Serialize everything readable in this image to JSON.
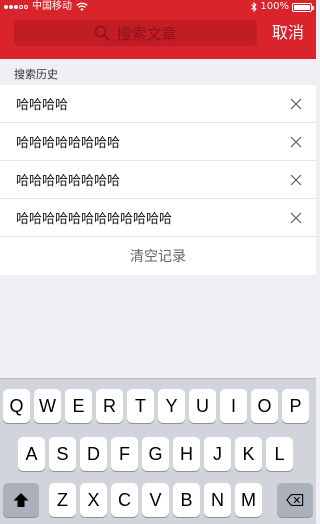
{
  "status_bar": {
    "carrier": "中国移动",
    "battery": "100%"
  },
  "search": {
    "placeholder": "搜索文章",
    "cancel_label": "取消"
  },
  "history": {
    "title": "搜索历史",
    "items": [
      {
        "label": "哈哈哈哈"
      },
      {
        "label": "哈哈哈哈哈哈哈哈"
      },
      {
        "label": "哈哈哈哈哈哈哈哈"
      },
      {
        "label": "哈哈哈哈哈哈哈哈哈哈哈哈"
      }
    ],
    "clear_label": "清空记录"
  },
  "keyboard": {
    "row1": [
      "Q",
      "W",
      "E",
      "R",
      "T",
      "Y",
      "U",
      "I",
      "O",
      "P"
    ],
    "row2": [
      "A",
      "S",
      "D",
      "F",
      "G",
      "H",
      "J",
      "K",
      "L"
    ],
    "row3": [
      "Z",
      "X",
      "C",
      "V",
      "B",
      "N",
      "M"
    ]
  },
  "colors": {
    "header": "#d9242b",
    "search_box": "#c21d24",
    "page_bg": "#efeff4",
    "keyboard_bg": "#d1d4db"
  }
}
